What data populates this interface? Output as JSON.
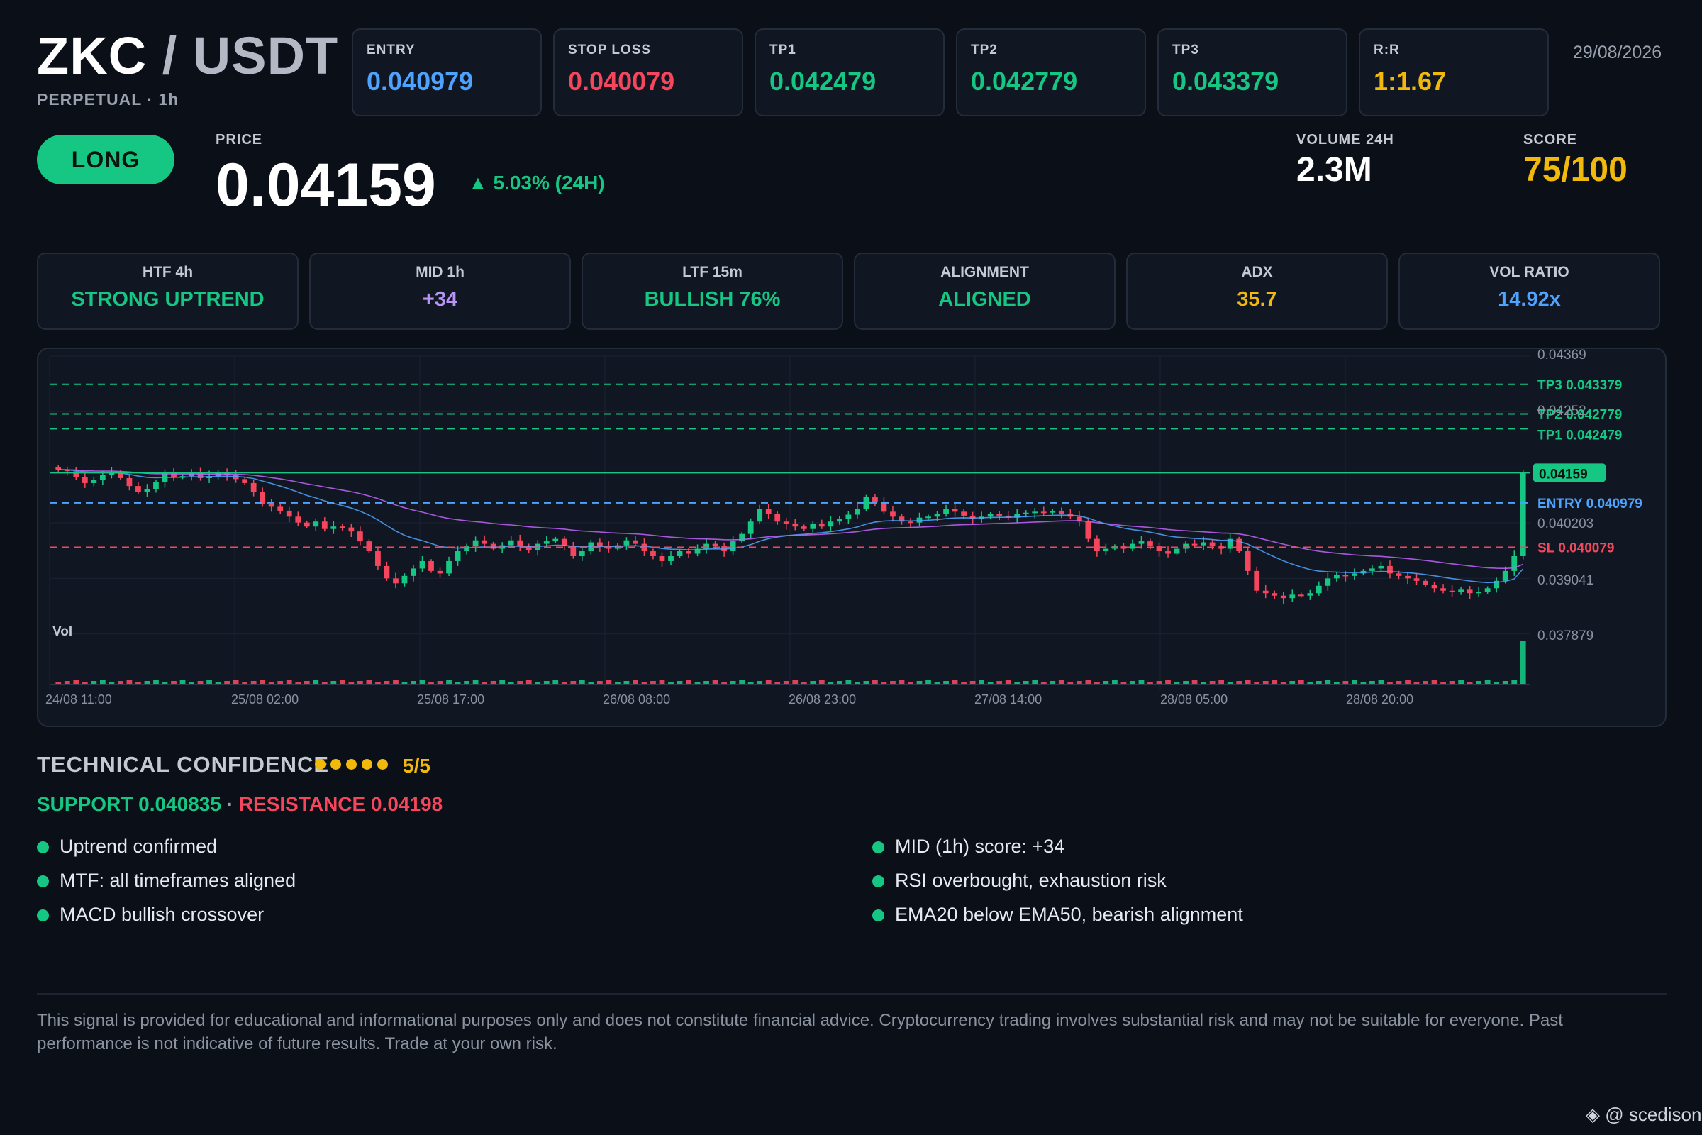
{
  "header": {
    "base": "ZKC",
    "separator": "/",
    "quote": "USDT",
    "subline": "PERPETUAL · 1h",
    "date": "29/08/2026"
  },
  "levels": [
    {
      "label": "ENTRY",
      "value": "0.040979",
      "color": "#4ea3ff"
    },
    {
      "label": "STOP LOSS",
      "value": "0.040079",
      "color": "#f6465d"
    },
    {
      "label": "TP1",
      "value": "0.042479",
      "color": "#16c784"
    },
    {
      "label": "TP2",
      "value": "0.042779",
      "color": "#16c784"
    },
    {
      "label": "TP3",
      "value": "0.043379",
      "color": "#16c784"
    },
    {
      "label": "R:R",
      "value": "1:1.67",
      "color": "#f0b90b"
    }
  ],
  "signal": {
    "direction": "LONG",
    "price_label": "PRICE",
    "price": "0.04159",
    "change": "▲ 5.03% (24H)",
    "volume_label": "VOLUME 24H",
    "volume": "2.3M",
    "score_label": "SCORE",
    "score": "75/100"
  },
  "timeframes": [
    {
      "label": "HTF 4h",
      "value": "STRONG UPTREND",
      "color": "#16c784"
    },
    {
      "label": "MID 1h",
      "value": "+34",
      "color": "#b794f6"
    },
    {
      "label": "LTF 15m",
      "value": "BULLISH 76%",
      "color": "#16c784"
    },
    {
      "label": "ALIGNMENT",
      "value": "ALIGNED",
      "color": "#16c784"
    },
    {
      "label": "ADX",
      "value": "35.7",
      "color": "#f0b90b"
    },
    {
      "label": "VOL RATIO",
      "value": "14.92x",
      "color": "#4ea3ff"
    }
  ],
  "chart_data": {
    "type": "candlestick",
    "y_axis_labels": [
      "0.04369",
      "0.04252",
      "0.04159",
      "0.040203",
      "0.039041",
      "0.037879"
    ],
    "x_axis_labels": [
      "24/08 11:00",
      "25/08 02:00",
      "25/08 17:00",
      "26/08 08:00",
      "26/08 23:00",
      "27/08 14:00",
      "28/08 05:00",
      "28/08 20:00"
    ],
    "ylim": [
      0.0372,
      0.04395
    ],
    "volume_label": "Vol",
    "current_price_tag": "0.04159",
    "levels": [
      {
        "label": "TP3 0.043379",
        "value": 0.043379,
        "color": "#16c784",
        "style": "dashed"
      },
      {
        "label": "TP2 0.042779",
        "value": 0.042779,
        "color": "#16c784",
        "style": "dashed"
      },
      {
        "label": "TP1 0.042479",
        "value": 0.042479,
        "color": "#16c784",
        "style": "dashed"
      },
      {
        "label": "ENTRY 0.040979",
        "value": 0.040979,
        "color": "#4ea3ff",
        "style": "dashed"
      },
      {
        "label": "SL 0.040079",
        "value": 0.040079,
        "color": "#f6465d",
        "style": "dashed"
      }
    ],
    "current_price": 0.04159,
    "close_series": [
      0.04165,
      0.04162,
      0.0415,
      0.04138,
      0.04145,
      0.04155,
      0.0416,
      0.04148,
      0.04132,
      0.0412,
      0.04125,
      0.0414,
      0.04158,
      0.0415,
      0.04152,
      0.0416,
      0.04148,
      0.04152,
      0.0416,
      0.04154,
      0.04146,
      0.04138,
      0.0412,
      0.04095,
      0.0409,
      0.04082,
      0.0407,
      0.04058,
      0.0405,
      0.0406,
      0.04045,
      0.0405,
      0.04048,
      0.0404,
      0.0402,
      0.04,
      0.0397,
      0.03945,
      0.03935,
      0.0395,
      0.03965,
      0.0398,
      0.0396,
      0.03955,
      0.0398,
      0.04,
      0.0401,
      0.04022,
      0.04015,
      0.04005,
      0.04012,
      0.04022,
      0.0401,
      0.04002,
      0.04015,
      0.0402,
      0.04025,
      0.0401,
      0.0399,
      0.04,
      0.04018,
      0.0401,
      0.04005,
      0.04012,
      0.04022,
      0.04015,
      0.04,
      0.0399,
      0.0398,
      0.0399,
      0.04,
      0.03995,
      0.04005,
      0.04015,
      0.0401,
      0.04,
      0.0402,
      0.04035,
      0.0406,
      0.04085,
      0.04075,
      0.0406,
      0.04055,
      0.0405,
      0.04045,
      0.04055,
      0.0405,
      0.0406,
      0.04066,
      0.04074,
      0.04085,
      0.0411,
      0.041,
      0.0408,
      0.0407,
      0.0406,
      0.04058,
      0.04068,
      0.0407,
      0.04075,
      0.04085,
      0.0408,
      0.04072,
      0.04065,
      0.0407,
      0.04075,
      0.04072,
      0.04068,
      0.04075,
      0.04078,
      0.0408,
      0.04078,
      0.04082,
      0.04076,
      0.0407,
      0.0406,
      0.04025,
      0.04,
      0.04005,
      0.0401,
      0.04005,
      0.04015,
      0.0402,
      0.0401,
      0.04,
      0.03995,
      0.04005,
      0.04015,
      0.04012,
      0.04018,
      0.0401,
      0.04005,
      0.04025,
      0.04,
      0.0396,
      0.0392,
      0.03915,
      0.0391,
      0.03905,
      0.03912,
      0.0391,
      0.03915,
      0.0393,
      0.03945,
      0.03952,
      0.0395,
      0.03955,
      0.0396,
      0.03965,
      0.0397,
      0.03955,
      0.0395,
      0.03945,
      0.0394,
      0.03932,
      0.03925,
      0.0392,
      0.03918,
      0.03922,
      0.03915,
      0.03918,
      0.03925,
      0.0394,
      0.0396,
      0.0399,
      0.04159
    ],
    "ema_series": [
      {
        "name": "EMA20",
        "color": "#4ea3ff"
      },
      {
        "name": "EMA50",
        "color": "#c264fe"
      }
    ]
  },
  "confidence": {
    "title": "TECHNICAL CONFIDENCE",
    "dots": 5,
    "score": "5/5",
    "support_label": "SUPPORT 0.040835",
    "separator": "·",
    "resistance_label": "RESISTANCE 0.04198"
  },
  "bullets_left": [
    "Uptrend confirmed",
    "MTF: all timeframes aligned",
    "MACD bullish crossover"
  ],
  "bullets_right": [
    "MID (1h) score: +34",
    "RSI overbought, exhaustion risk",
    "EMA20 below EMA50, bearish alignment"
  ],
  "disclaimer": "This signal is provided for educational and informational purposes only and does not constitute financial advice. Cryptocurrency trading involves substantial risk and may not be suitable for everyone. Past performance is not indicative of future results. Trade at your own risk.",
  "watermark": "@ scedison"
}
